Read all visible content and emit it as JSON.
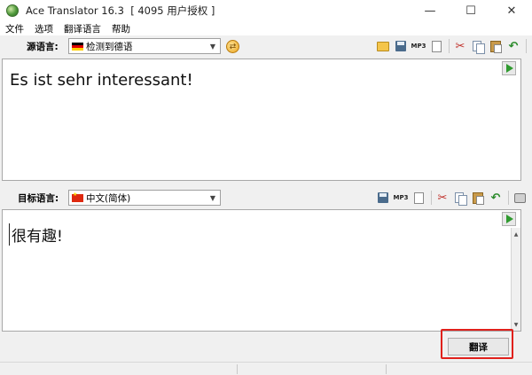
{
  "window": {
    "title": "Ace Translator 16.3  [ 4095 用户授权 ]",
    "controls": {
      "minimize": "—",
      "maximize": "☐",
      "close": "✕"
    }
  },
  "menu": [
    "文件",
    "选项",
    "翻译语言",
    "帮助"
  ],
  "source": {
    "label": "源语言:",
    "language": "检测到德语",
    "flag": "de",
    "text": "Es ist sehr interessant!"
  },
  "target": {
    "label": "目标语言:",
    "language": "中文(简体)",
    "flag": "cn",
    "text": "很有趣!"
  },
  "toolbar_icons": {
    "mp3_label": "MP3"
  },
  "translate_button": "翻译",
  "colors": {
    "highlight": "#e0211c",
    "play": "#2f9a2f"
  }
}
